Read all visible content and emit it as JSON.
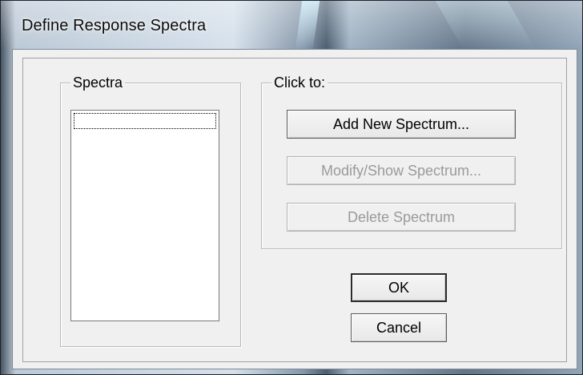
{
  "window": {
    "title": "Define Response Spectra"
  },
  "spectra_group": {
    "label": "Spectra",
    "items": [
      ""
    ]
  },
  "actions_group": {
    "label": "Click to:",
    "add_label": "Add New Spectrum...",
    "modify_label": "Modify/Show Spectrum...",
    "delete_label": "Delete Spectrum"
  },
  "footer": {
    "ok_label": "OK",
    "cancel_label": "Cancel"
  }
}
